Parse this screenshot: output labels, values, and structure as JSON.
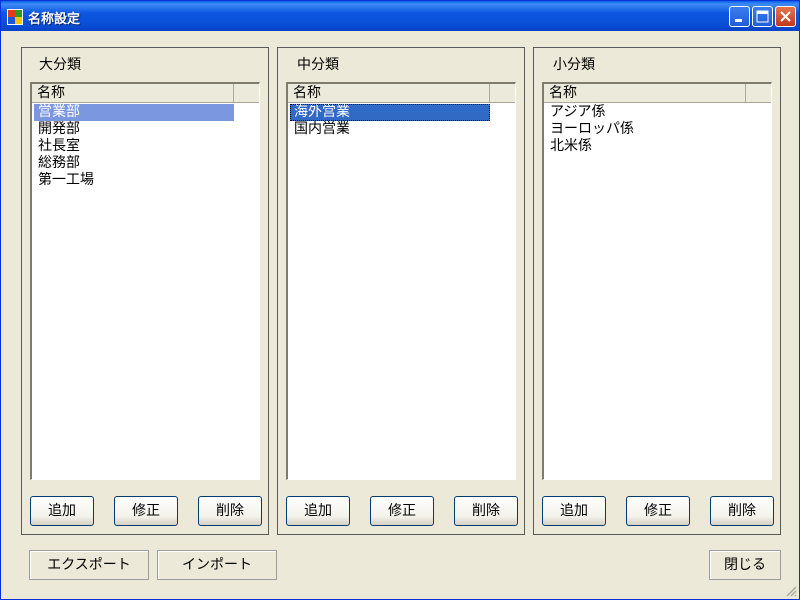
{
  "window": {
    "title": "名称設定",
    "controls": {
      "minimize": "minimize-icon",
      "maximize": "maximize-icon",
      "close": "close-icon"
    }
  },
  "groups": [
    {
      "title": "大分類",
      "column_header": "名称",
      "items": [
        "営業部",
        "開発部",
        "社長室",
        "総務部",
        "第一工場"
      ],
      "buttons": {
        "add": "追加",
        "edit": "修正",
        "delete": "削除"
      }
    },
    {
      "title": "中分類",
      "column_header": "名称",
      "items": [
        "海外営業",
        "国内営業"
      ],
      "buttons": {
        "add": "追加",
        "edit": "修正",
        "delete": "削除"
      }
    },
    {
      "title": "小分類",
      "column_header": "名称",
      "items": [
        "アジア係",
        "ヨーロッパ係",
        "北米係"
      ],
      "buttons": {
        "add": "追加",
        "edit": "修正",
        "delete": "削除"
      }
    }
  ],
  "footer": {
    "export": "エクスポート",
    "import": "インポート",
    "close": "閉じる"
  },
  "colors": {
    "selection_active": "#316ac5",
    "selection_inactive": "#7b97e0",
    "window_bg": "#ece9d8",
    "titlebar": "#0a4ed6"
  }
}
